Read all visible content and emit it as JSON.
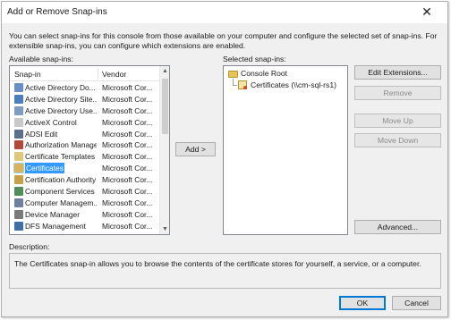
{
  "window": {
    "title": "Add or Remove Snap-ins",
    "close_glyph": "✕"
  },
  "intro": "You can select snap-ins for this console from those available on your computer and configure the selected set of snap-ins. For extensible snap-ins, you can configure which extensions are enabled.",
  "available": {
    "label": "Available snap-ins:",
    "col_snapin": "Snap-in",
    "col_vendor": "Vendor",
    "items": [
      {
        "name": "Active Directory Do...",
        "vendor": "Microsoft Cor...",
        "icon": "directory-icon",
        "color": "#6a8fc7"
      },
      {
        "name": "Active Directory Site...",
        "vendor": "Microsoft Cor...",
        "icon": "sites-icon",
        "color": "#4d7fbf"
      },
      {
        "name": "Active Directory Use...",
        "vendor": "Microsoft Cor...",
        "icon": "users-icon",
        "color": "#7f9cc4"
      },
      {
        "name": "ActiveX Control",
        "vendor": "Microsoft Cor...",
        "icon": "activex-icon",
        "color": "#c9c9c9"
      },
      {
        "name": "ADSI Edit",
        "vendor": "Microsoft Cor...",
        "icon": "adsi-icon",
        "color": "#5a6f8a"
      },
      {
        "name": "Authorization Manager",
        "vendor": "Microsoft Cor...",
        "icon": "auth-icon",
        "color": "#b0493a"
      },
      {
        "name": "Certificate Templates",
        "vendor": "Microsoft Cor...",
        "icon": "template-icon",
        "color": "#e0c77a"
      },
      {
        "name": "Certificates",
        "vendor": "Microsoft Cor...",
        "icon": "certificate-icon",
        "color": "#d8b35a"
      },
      {
        "name": "Certification Authority",
        "vendor": "Microsoft Cor...",
        "icon": "ca-icon",
        "color": "#c8a04a"
      },
      {
        "name": "Component Services",
        "vendor": "Microsoft Cor...",
        "icon": "component-icon",
        "color": "#4f8f5a"
      },
      {
        "name": "Computer Managem...",
        "vendor": "Microsoft Cor...",
        "icon": "computer-icon",
        "color": "#6f7f9f"
      },
      {
        "name": "Device Manager",
        "vendor": "Microsoft Cor...",
        "icon": "device-icon",
        "color": "#7a7a7a"
      },
      {
        "name": "DFS Management",
        "vendor": "Microsoft Cor...",
        "icon": "dfs-icon",
        "color": "#3f6fa8"
      }
    ],
    "selected_index": 7
  },
  "add_button": "Add >",
  "selected": {
    "label": "Selected snap-ins:",
    "root": "Console Root",
    "child": "Certificates (\\\\cm-sql-rs1)"
  },
  "buttons": {
    "edit_extensions": "Edit Extensions...",
    "remove": "Remove",
    "move_up": "Move Up",
    "move_down": "Move Down",
    "advanced": "Advanced...",
    "ok": "OK",
    "cancel": "Cancel"
  },
  "description": {
    "label": "Description:",
    "text": "The Certificates snap-in allows you to browse the contents of the certificate stores for yourself, a service, or a computer."
  },
  "colors": {
    "selection": "#3399ff",
    "accent": "#0078d7"
  }
}
